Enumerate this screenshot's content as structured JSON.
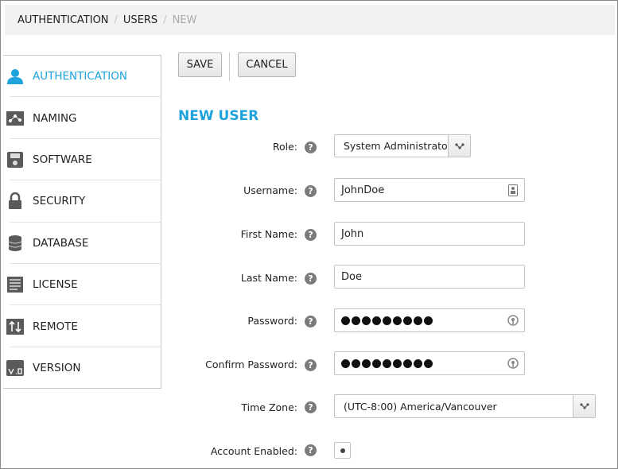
{
  "breadcrumb": {
    "items": [
      "AUTHENTICATION",
      "USERS",
      "NEW"
    ],
    "separator": "/"
  },
  "sidebar": {
    "items": [
      {
        "label": "AUTHENTICATION",
        "icon": "user-icon",
        "active": true
      },
      {
        "label": "NAMING",
        "icon": "naming-icon",
        "active": false
      },
      {
        "label": "SOFTWARE",
        "icon": "software-icon",
        "active": false
      },
      {
        "label": "SECURITY",
        "icon": "lock-icon",
        "active": false
      },
      {
        "label": "DATABASE",
        "icon": "database-icon",
        "active": false
      },
      {
        "label": "LICENSE",
        "icon": "license-icon",
        "active": false
      },
      {
        "label": "REMOTE",
        "icon": "remote-icon",
        "active": false
      },
      {
        "label": "VERSION",
        "icon": "version-icon",
        "active": false
      }
    ]
  },
  "toolbar": {
    "save_label": "SAVE",
    "cancel_label": "CANCEL"
  },
  "form": {
    "title": "NEW USER",
    "help_glyph": "?",
    "role": {
      "label": "Role:",
      "value": "System Administrator"
    },
    "username": {
      "label": "Username:",
      "value": "JohnDoe"
    },
    "first_name": {
      "label": "First Name:",
      "value": "John"
    },
    "last_name": {
      "label": "Last Name:",
      "value": "Doe"
    },
    "password": {
      "label": "Password:",
      "masked_length": 9
    },
    "confirm_password": {
      "label": "Confirm Password:",
      "masked_length": 9
    },
    "time_zone": {
      "label": "Time Zone:",
      "value": "(UTC-8:00) America/Vancouver"
    },
    "account_enabled": {
      "label": "Account Enabled:",
      "checked": true
    }
  },
  "colors": {
    "accent": "#1ea3dc",
    "breadcrumb_bg": "#f2f2f2",
    "help_icon": "#7b7b7b"
  }
}
